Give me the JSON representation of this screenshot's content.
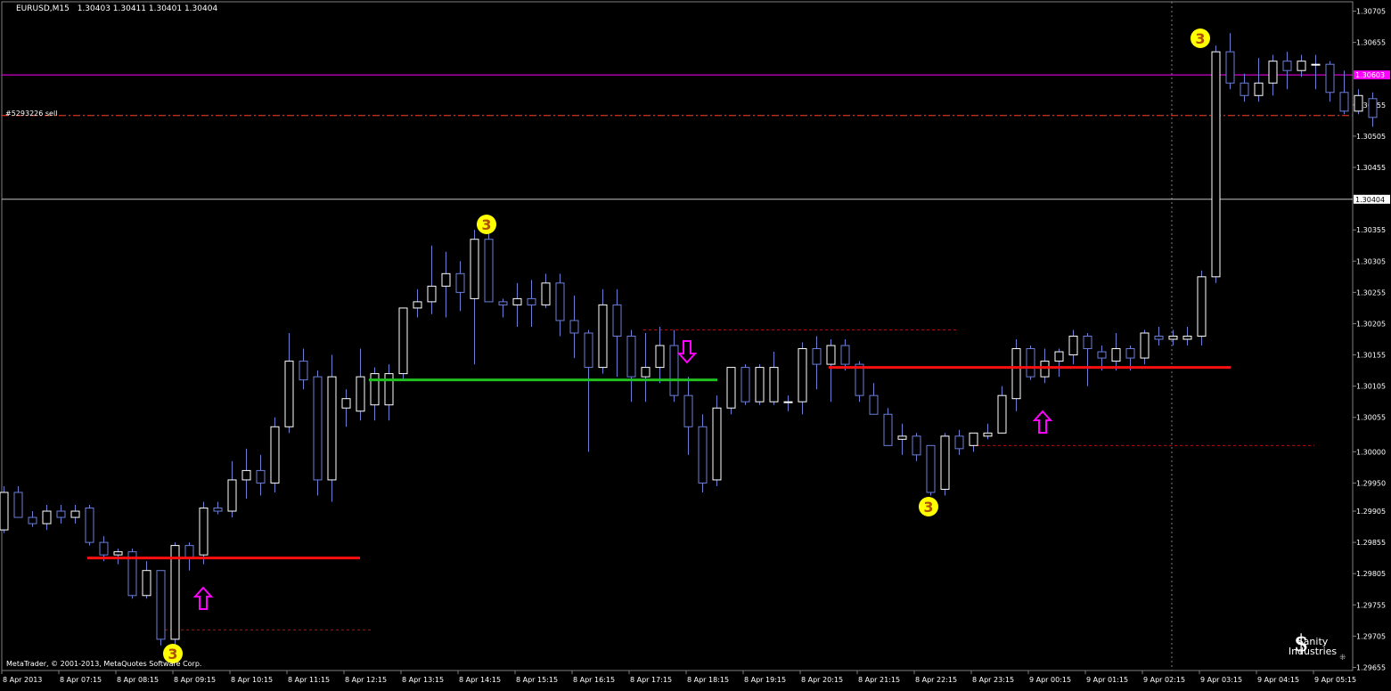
{
  "header": {
    "symbol": "EURUSD,M15",
    "ohlc": "1.30403 1.30411 1.30401 1.30404"
  },
  "footer": {
    "copyright": "MetaTrader, © 2001-2013, MetaQuotes Software Corp."
  },
  "watermark": {
    "text": "Sanity Industries"
  },
  "colors": {
    "background": "#000000",
    "candle": "#6b7fd6",
    "grid": "#333333",
    "axis_text": "#ffffff",
    "magenta_line": "#ff00ff",
    "bid_line": "#c0c0c0",
    "sell_line": "#ff4020",
    "red_level": "#ff1010",
    "green_level": "#20c020",
    "marker_fill": "#ffff00",
    "arrow": "#ff00ff"
  },
  "chart_data": {
    "type": "candlestick",
    "title": "EURUSD,M15",
    "y_range": [
      1.2965,
      1.3072
    ],
    "y_ticks": [
      "1.30705",
      "1.30655",
      "1.30555",
      "1.30505",
      "1.30455",
      "1.30355",
      "1.30305",
      "1.30255",
      "1.30205",
      "1.30155",
      "1.30105",
      "1.30055",
      "1.30000",
      "1.29950",
      "1.29905",
      "1.29855",
      "1.29805",
      "1.29755",
      "1.29705",
      "1.29655"
    ],
    "x_ticks": [
      "8 Apr 2013",
      "8 Apr 07:15",
      "8 Apr 08:15",
      "8 Apr 09:15",
      "8 Apr 10:15",
      "8 Apr 11:15",
      "8 Apr 12:15",
      "8 Apr 13:15",
      "8 Apr 14:15",
      "8 Apr 15:15",
      "8 Apr 16:15",
      "8 Apr 17:15",
      "8 Apr 18:15",
      "8 Apr 19:15",
      "8 Apr 20:15",
      "8 Apr 21:15",
      "8 Apr 22:15",
      "8 Apr 23:15",
      "9 Apr 00:15",
      "9 Apr 01:15",
      "9 Apr 02:15",
      "9 Apr 03:15",
      "9 Apr 04:15",
      "9 Apr 05:15"
    ],
    "candles": [
      [
        1.29875,
        1.29945,
        1.2987,
        1.29935
      ],
      [
        1.29935,
        1.29945,
        1.29895,
        1.29895
      ],
      [
        1.29895,
        1.29905,
        1.2988,
        1.29885
      ],
      [
        1.29885,
        1.29915,
        1.29875,
        1.29905
      ],
      [
        1.29905,
        1.29915,
        1.29885,
        1.29895
      ],
      [
        1.29895,
        1.29915,
        1.29885,
        1.29905
      ],
      [
        1.2991,
        1.29915,
        1.2985,
        1.29855
      ],
      [
        1.29855,
        1.29865,
        1.29825,
        1.29835
      ],
      [
        1.29835,
        1.29845,
        1.2982,
        1.2984
      ],
      [
        1.2984,
        1.29845,
        1.29765,
        1.2977
      ],
      [
        1.2977,
        1.29825,
        1.29765,
        1.2981
      ],
      [
        1.2981,
        1.2981,
        1.2969,
        1.297
      ],
      [
        1.297,
        1.29855,
        1.2969,
        1.2985
      ],
      [
        1.2985,
        1.29855,
        1.2981,
        1.2983
      ],
      [
        1.29835,
        1.2992,
        1.2982,
        1.2991
      ],
      [
        1.2991,
        1.2992,
        1.299,
        1.29905
      ],
      [
        1.29905,
        1.29985,
        1.29895,
        1.29955
      ],
      [
        1.29955,
        1.30005,
        1.29925,
        1.2997
      ],
      [
        1.2997,
        1.29995,
        1.2993,
        1.2995
      ],
      [
        1.2995,
        1.30055,
        1.29935,
        1.3004
      ],
      [
        1.3004,
        1.3019,
        1.3003,
        1.30145
      ],
      [
        1.30145,
        1.30165,
        1.301,
        1.30115
      ],
      [
        1.3012,
        1.3013,
        1.2993,
        1.29955
      ],
      [
        1.29955,
        1.30155,
        1.2992,
        1.3012
      ],
      [
        1.3007,
        1.301,
        1.3004,
        1.30085
      ],
      [
        1.30065,
        1.30165,
        1.3005,
        1.3012
      ],
      [
        1.30075,
        1.30135,
        1.3005,
        1.30125
      ],
      [
        1.30075,
        1.3014,
        1.3005,
        1.30125
      ],
      [
        1.30125,
        1.3023,
        1.30115,
        1.3023
      ],
      [
        1.3023,
        1.3026,
        1.30215,
        1.3024
      ],
      [
        1.3024,
        1.3033,
        1.3022,
        1.30265
      ],
      [
        1.30265,
        1.3032,
        1.30215,
        1.30285
      ],
      [
        1.30285,
        1.30305,
        1.30225,
        1.30255
      ],
      [
        1.30245,
        1.30355,
        1.3014,
        1.3034
      ],
      [
        1.3034,
        1.3036,
        1.3024,
        1.3024
      ],
      [
        1.3024,
        1.30245,
        1.30215,
        1.30235
      ],
      [
        1.30235,
        1.3027,
        1.302,
        1.30245
      ],
      [
        1.30245,
        1.30275,
        1.302,
        1.30235
      ],
      [
        1.30235,
        1.30285,
        1.3023,
        1.3027
      ],
      [
        1.3027,
        1.30285,
        1.30185,
        1.3021
      ],
      [
        1.3021,
        1.3025,
        1.3015,
        1.3019
      ],
      [
        1.3019,
        1.30195,
        1.3,
        1.30135
      ],
      [
        1.30135,
        1.3026,
        1.30125,
        1.30235
      ],
      [
        1.30235,
        1.3026,
        1.3012,
        1.30185
      ],
      [
        1.30185,
        1.30195,
        1.3008,
        1.3012
      ],
      [
        1.3012,
        1.3019,
        1.3008,
        1.30135
      ],
      [
        1.30135,
        1.302,
        1.3011,
        1.3017
      ],
      [
        1.3017,
        1.30195,
        1.3008,
        1.3009
      ],
      [
        1.3009,
        1.3012,
        1.29995,
        1.3004
      ],
      [
        1.3004,
        1.3006,
        1.29935,
        1.2995
      ],
      [
        1.29955,
        1.3009,
        1.29945,
        1.3007
      ],
      [
        1.3007,
        1.30135,
        1.3006,
        1.30135
      ],
      [
        1.30135,
        1.3014,
        1.30075,
        1.3008
      ],
      [
        1.3008,
        1.3014,
        1.30075,
        1.30135
      ],
      [
        1.3008,
        1.3016,
        1.30075,
        1.30135
      ],
      [
        1.3008,
        1.3009,
        1.30065,
        1.3008
      ],
      [
        1.3008,
        1.30175,
        1.3006,
        1.30165
      ],
      [
        1.30165,
        1.30185,
        1.301,
        1.3014
      ],
      [
        1.3014,
        1.3018,
        1.3008,
        1.3017
      ],
      [
        1.3017,
        1.3018,
        1.3013,
        1.3014
      ],
      [
        1.3014,
        1.30145,
        1.3008,
        1.3009
      ],
      [
        1.3009,
        1.3011,
        1.3006,
        1.3006
      ],
      [
        1.3006,
        1.3007,
        1.3001,
        1.3001
      ],
      [
        1.3002,
        1.30045,
        1.29995,
        1.30025
      ],
      [
        1.30025,
        1.3003,
        1.29985,
        1.29995
      ],
      [
        1.3001,
        1.3001,
        1.2993,
        1.29935
      ],
      [
        1.2994,
        1.3003,
        1.2993,
        1.30025
      ],
      [
        1.30025,
        1.30035,
        1.29995,
        1.30005
      ],
      [
        1.3001,
        1.3003,
        1.3,
        1.3003
      ],
      [
        1.30025,
        1.30045,
        1.3002,
        1.3003
      ],
      [
        1.3003,
        1.30105,
        1.3003,
        1.3009
      ],
      [
        1.30085,
        1.3018,
        1.30065,
        1.30165
      ],
      [
        1.30165,
        1.3017,
        1.30115,
        1.3012
      ],
      [
        1.3012,
        1.30165,
        1.3011,
        1.30145
      ],
      [
        1.30145,
        1.30165,
        1.3012,
        1.3016
      ],
      [
        1.30155,
        1.30195,
        1.3014,
        1.30185
      ],
      [
        1.30185,
        1.3019,
        1.30105,
        1.30165
      ],
      [
        1.3016,
        1.3017,
        1.3013,
        1.3015
      ],
      [
        1.30145,
        1.3019,
        1.3013,
        1.30165
      ],
      [
        1.30165,
        1.3017,
        1.3013,
        1.3015
      ],
      [
        1.3015,
        1.30195,
        1.3014,
        1.3019
      ],
      [
        1.30185,
        1.302,
        1.3017,
        1.3018
      ],
      [
        1.3018,
        1.30195,
        1.3017,
        1.30185
      ],
      [
        1.3018,
        1.302,
        1.3017,
        1.30185
      ],
      [
        1.30185,
        1.3029,
        1.3017,
        1.3028
      ],
      [
        1.3028,
        1.3065,
        1.3027,
        1.3064
      ],
      [
        1.3064,
        1.3067,
        1.3058,
        1.3059
      ],
      [
        1.3059,
        1.30605,
        1.3056,
        1.3057
      ],
      [
        1.3057,
        1.3063,
        1.3056,
        1.3059
      ],
      [
        1.3059,
        1.30635,
        1.3057,
        1.30625
      ],
      [
        1.30625,
        1.3064,
        1.3058,
        1.3061
      ],
      [
        1.3061,
        1.30635,
        1.306,
        1.30625
      ],
      [
        1.3062,
        1.30635,
        1.3058,
        1.3062
      ],
      [
        1.3062,
        1.30625,
        1.3056,
        1.30575
      ],
      [
        1.30575,
        1.3061,
        1.3054,
        1.30545
      ],
      [
        1.30545,
        1.3058,
        1.3054,
        1.3057
      ],
      [
        1.30565,
        1.30575,
        1.3052,
        1.30535
      ]
    ],
    "levels": [
      {
        "label": "1.30603",
        "price": 1.30603,
        "color": "#ff00ff"
      },
      {
        "label": "1.30404",
        "price": 1.30404,
        "color": "#c0c0c0"
      },
      {
        "label": "#5293226 sell",
        "price": 1.30538,
        "color": "#ff4020"
      }
    ],
    "markers": {
      "swing_label": "3",
      "arrow_up": "⇧",
      "arrow_down": "⇩"
    }
  }
}
